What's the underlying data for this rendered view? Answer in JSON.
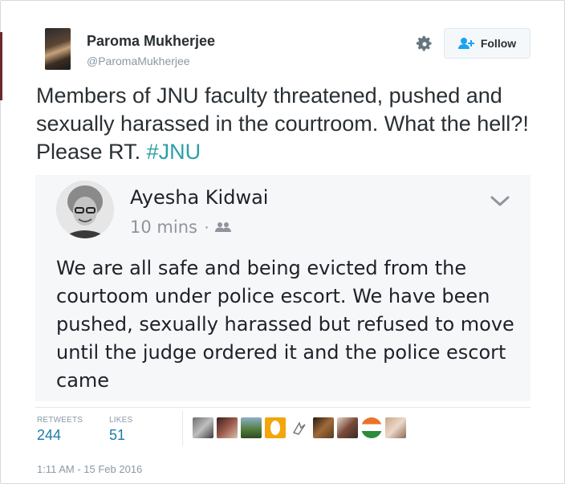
{
  "user": {
    "display_name": "Paroma Mukherjee",
    "handle": "@ParomaMukherjee"
  },
  "actions": {
    "follow_label": "Follow",
    "gear_icon": "gear-icon",
    "follow_icon": "add-user-icon"
  },
  "tweet": {
    "text": "Members of JNU faculty threatened, pushed and sexually harassed in the courtroom. What the hell?! Please RT. ",
    "hashtag": "#JNU"
  },
  "embedded_post": {
    "author": "Ayesha Kidwai",
    "time": "10 mins",
    "separator": "·",
    "audience_icon": "friends-icon",
    "menu_icon": "chevron-down-icon",
    "text": "We are all safe and being evicted from the courtoom under police escort. We have been pushed, sexually harassed but refused to move until the judge ordered it and the police escort came"
  },
  "stats": {
    "retweets_label": "RETWEETS",
    "retweets_value": "244",
    "likes_label": "LIKES",
    "likes_value": "51"
  },
  "timestamp": "1:11 AM - 15 Feb 2016",
  "colors": {
    "hashtag": "#2b9fa7",
    "stat_value": "#1e7ba8"
  }
}
